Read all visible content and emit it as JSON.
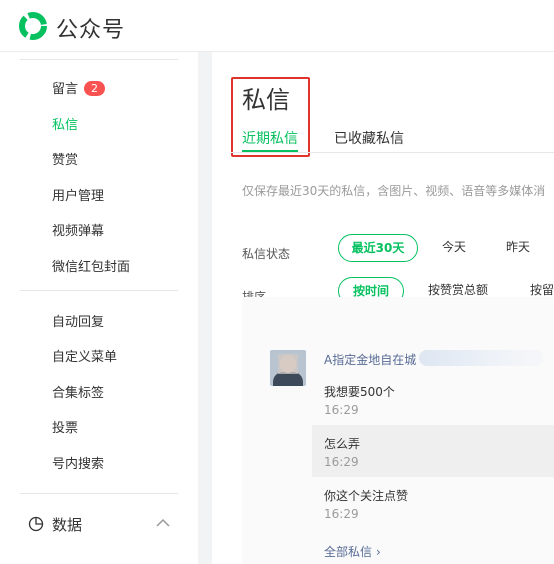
{
  "header": {
    "title": "公众号"
  },
  "sidebar": {
    "items": [
      {
        "label": "留言",
        "badge": "2"
      },
      {
        "label": "私信",
        "active": true
      },
      {
        "label": "赞赏"
      },
      {
        "label": "用户管理"
      },
      {
        "label": "视频弹幕"
      },
      {
        "label": "微信红包封面"
      },
      {
        "label": "自动回复"
      },
      {
        "label": "自定义菜单"
      },
      {
        "label": "合集标签"
      },
      {
        "label": "投票"
      },
      {
        "label": "号内搜索"
      }
    ],
    "section": {
      "label": "数据",
      "icon": "pie-chart-icon",
      "chevron": "chevron-up-icon"
    }
  },
  "main": {
    "title": "私信",
    "tabs": [
      {
        "label": "近期私信",
        "active": true
      },
      {
        "label": "已收藏私信"
      }
    ],
    "notice": "仅保存最近30天的私信，含图片、视频、语音等多媒体消",
    "filters": {
      "status": {
        "label": "私信状态",
        "options": [
          "最近30天",
          "今天",
          "昨天"
        ],
        "selected": "最近30天"
      },
      "sort": {
        "label": "排序",
        "options": [
          "按时间",
          "按赞赏总额",
          "按留言"
        ],
        "selected": "按时间"
      }
    },
    "conversation": {
      "sender": "A指定金地自在城",
      "messages": [
        {
          "text": "我想要500个",
          "time": "16:29"
        },
        {
          "text": "怎么弄",
          "time": "16:29"
        },
        {
          "text": "你这个关注点赞",
          "time": "16:29"
        }
      ],
      "all_link": "全部私信"
    }
  },
  "colors": {
    "accent": "#07c160",
    "badge": "#fa5151",
    "highlight": "#e0332e",
    "link": "#576b95"
  }
}
